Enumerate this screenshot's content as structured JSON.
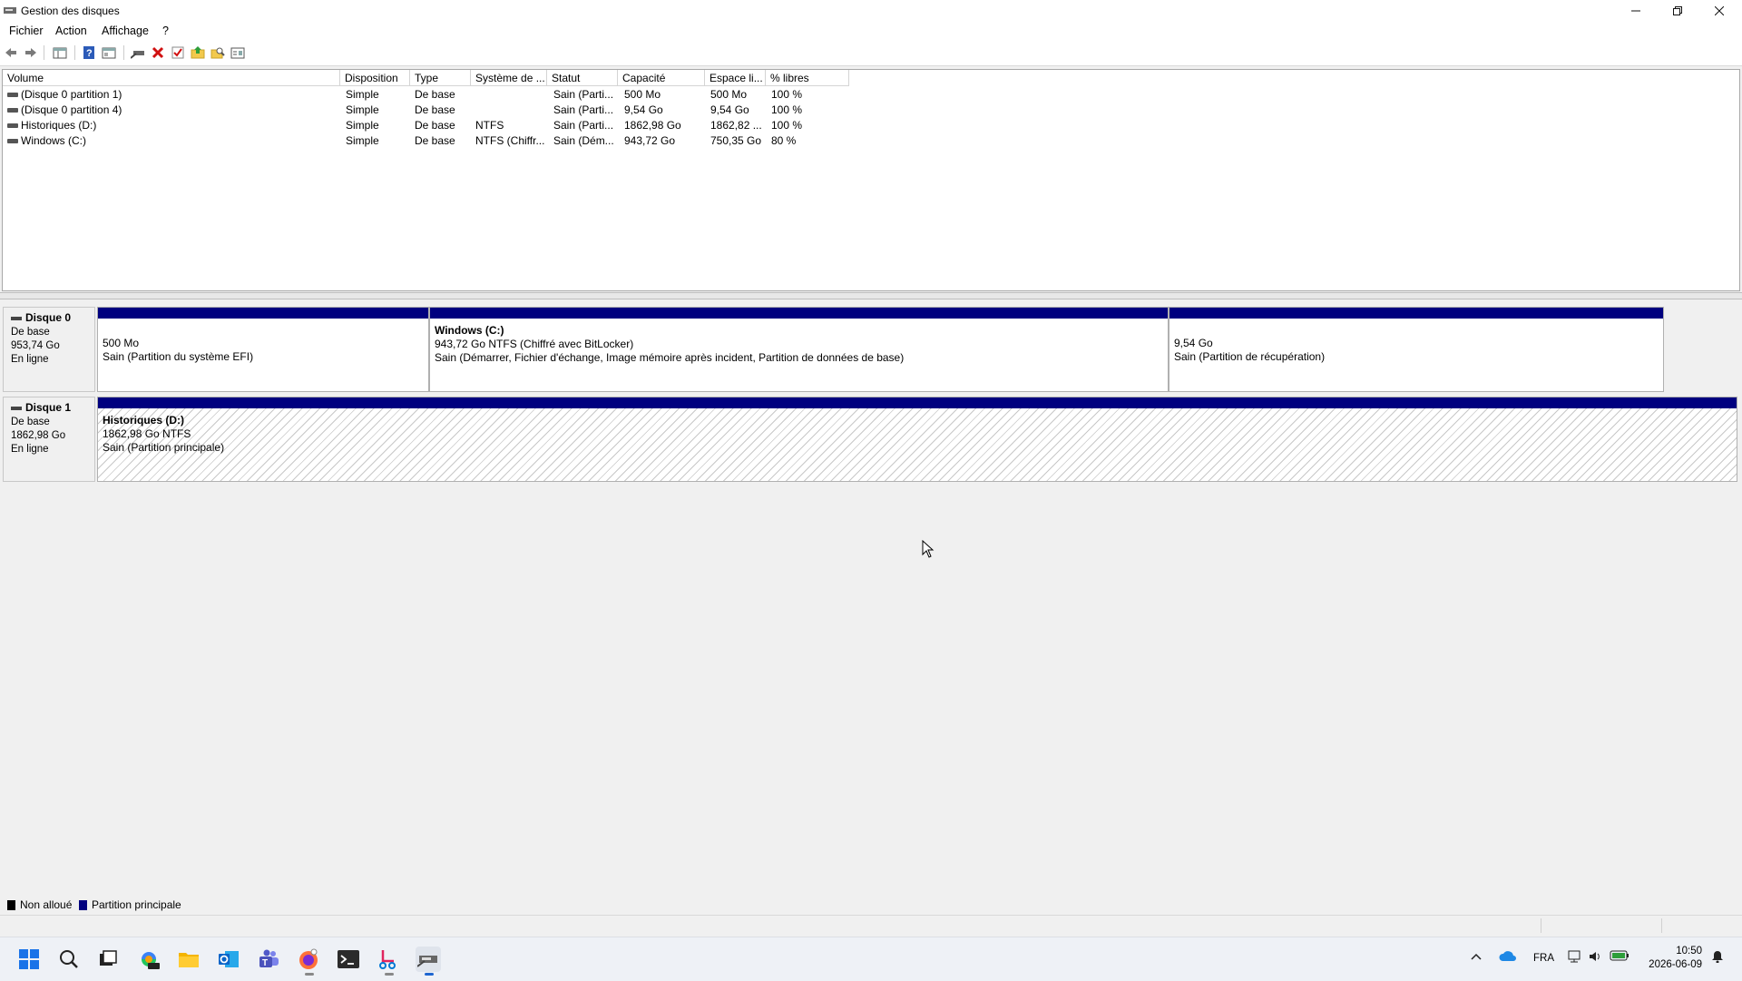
{
  "window": {
    "title": "Gestion des disques"
  },
  "menu": [
    "Fichier",
    "Action",
    "Affichage",
    "?"
  ],
  "toolbar_icons": [
    "back-icon",
    "forward-icon",
    "console-tree-icon",
    "help-icon",
    "properties-icon",
    "connect-disk-icon",
    "delete-icon",
    "check-icon",
    "folder-up-icon",
    "folder-search-icon",
    "settings-list-icon"
  ],
  "columns": [
    "Volume",
    "Disposition",
    "Type",
    "Système de ...",
    "Statut",
    "Capacité",
    "Espace li...",
    "% libres"
  ],
  "volumes": [
    {
      "volume": "(Disque 0 partition 1)",
      "disposition": "Simple",
      "type": "De base",
      "fs": "",
      "status": "Sain (Parti...",
      "capacity": "500 Mo",
      "free": "500 Mo",
      "pct": "100 %"
    },
    {
      "volume": "(Disque 0 partition 4)",
      "disposition": "Simple",
      "type": "De base",
      "fs": "",
      "status": "Sain (Parti...",
      "capacity": "9,54 Go",
      "free": "9,54 Go",
      "pct": "100 %"
    },
    {
      "volume": "Historiques (D:)",
      "disposition": "Simple",
      "type": "De base",
      "fs": "NTFS",
      "status": "Sain (Parti...",
      "capacity": "1862,98 Go",
      "free": "1862,82 ...",
      "pct": "100 %"
    },
    {
      "volume": "Windows (C:)",
      "disposition": "Simple",
      "type": "De base",
      "fs": "NTFS (Chiffr...",
      "status": "Sain (Dém...",
      "capacity": "943,72 Go",
      "free": "750,35 Go",
      "pct": "80 %"
    }
  ],
  "disks": [
    {
      "name": "Disque 0",
      "kind": "De base",
      "size": "953,74 Go",
      "state": "En ligne",
      "partitions": [
        {
          "title": "",
          "line1": "500 Mo",
          "line2": "Sain (Partition du système EFI)"
        },
        {
          "title": "Windows  (C:)",
          "line1": "943,72 Go NTFS (Chiffré avec BitLocker)",
          "line2": "Sain (Démarrer, Fichier d'échange, Image mémoire après incident, Partition de données de base)"
        },
        {
          "title": "",
          "line1": "9,54 Go",
          "line2": "Sain (Partition de récupération)"
        }
      ]
    },
    {
      "name": "Disque 1",
      "kind": "De base",
      "size": "1862,98 Go",
      "state": "En ligne",
      "partitions": [
        {
          "title": "Historiques  (D:)",
          "line1": "1862,98 Go NTFS",
          "line2": "Sain (Partition principale)"
        }
      ]
    }
  ],
  "legend": [
    {
      "label": "Non alloué",
      "color": "#000000"
    },
    {
      "label": "Partition principale",
      "color": "#00007f"
    }
  ],
  "taskbar": {
    "apps": [
      "start-icon",
      "search-icon",
      "task-view-icon",
      "m365-copilot-icon",
      "file-explorer-icon",
      "outlook-icon",
      "teams-icon",
      "firefox-icon",
      "terminal-icon",
      "snipping-tool-icon",
      "disk-management-icon"
    ],
    "lang": "FRA",
    "time": "10:50",
    "date": "2026-06-09"
  },
  "colors": {
    "primary_partition": "#00007f",
    "accent": "#1e66d0"
  }
}
